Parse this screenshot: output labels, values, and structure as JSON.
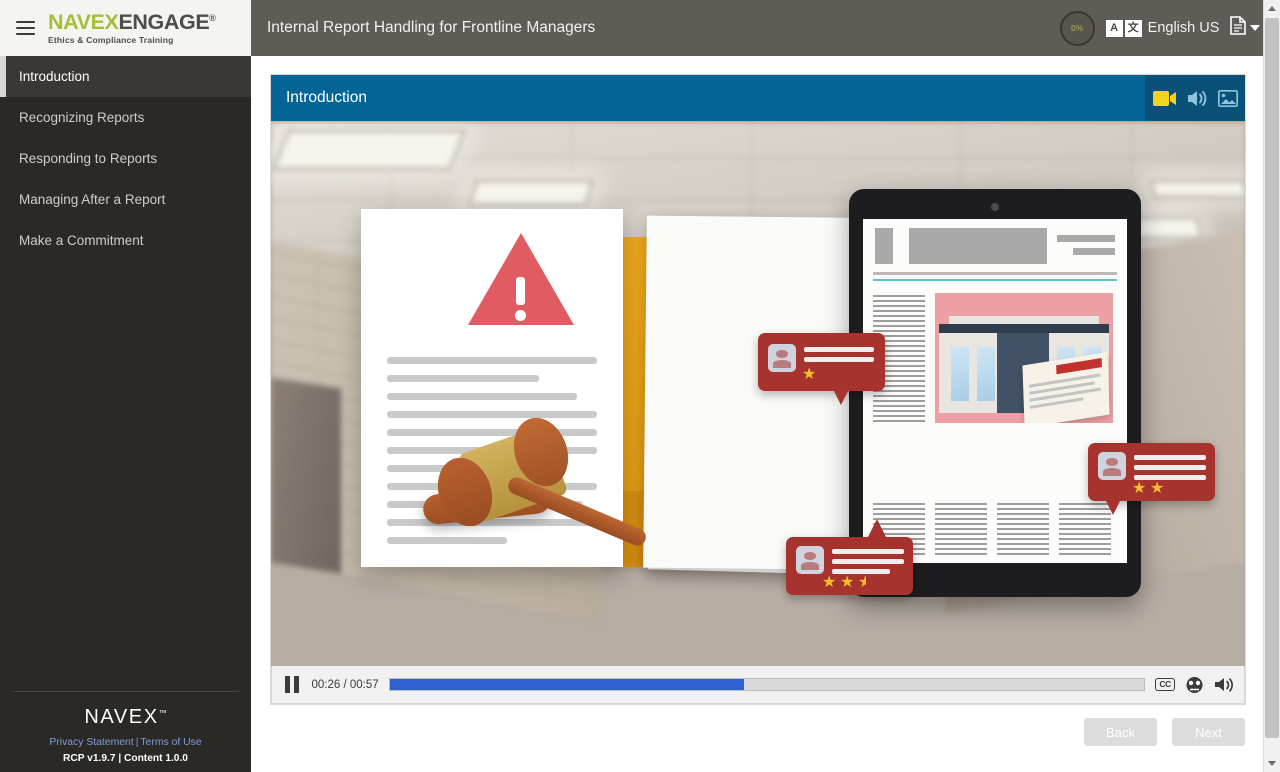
{
  "brand": {
    "logo_primary": "NAVEX",
    "logo_secondary": "ENGAGE",
    "logo_registered": "®",
    "logo_tagline": "Ethics & Compliance Training",
    "footer_logo": "NAVEX",
    "footer_logo_tm": "™"
  },
  "header": {
    "title": "Internal Report Handling for Frontline Managers",
    "progress_percent": "0%",
    "language_icon_letter": "A",
    "language_icon_glyph": "文",
    "language_label": "English US",
    "close_label": "✕"
  },
  "sidebar": {
    "items": [
      {
        "label": "Introduction",
        "active": true
      },
      {
        "label": "Recognizing Reports",
        "active": false
      },
      {
        "label": "Responding to Reports",
        "active": false
      },
      {
        "label": "Managing After a Report",
        "active": false
      },
      {
        "label": "Make a Commitment",
        "active": false
      }
    ],
    "footer": {
      "privacy_label": "Privacy Statement",
      "separator": "|",
      "terms_label": "Terms of Use",
      "version": "RCP v1.9.7 | Content 1.0.0"
    }
  },
  "content": {
    "panel_title": "Introduction",
    "media_icons": [
      "video-icon",
      "audio-icon",
      "image-icon"
    ],
    "illustration": {
      "scene": "office-hallway-with-report-documents-gavel-and-tablet",
      "review_cards": [
        {
          "stars": 1,
          "lines": 2
        },
        {
          "stars": 2,
          "lines": 3
        },
        {
          "stars": 2.5,
          "lines": 3
        }
      ]
    }
  },
  "player": {
    "play_state": "pause",
    "time_current": "00:26",
    "time_separator": "/",
    "time_total": "00:57",
    "time_display": "00:26 / 00:57",
    "progress_percent": 47,
    "cc_label": "CC",
    "icons": [
      "cc-icon",
      "playback-speed-icon",
      "volume-icon"
    ]
  },
  "navigation": {
    "back_label": "Back",
    "next_label": "Next",
    "back_disabled": true,
    "next_disabled": true
  },
  "colors": {
    "sidebar_bg": "#2b2926",
    "topbar_bg": "#5f5c57",
    "panel_header_blue": "#036595",
    "accent_green": "#a3bf3a",
    "progress_blue": "#2f62d0",
    "review_card_red": "#a7332f",
    "star_yellow": "#f4bf2a",
    "folder_orange": "#f0a91e",
    "warning_red": "#e05b62"
  }
}
